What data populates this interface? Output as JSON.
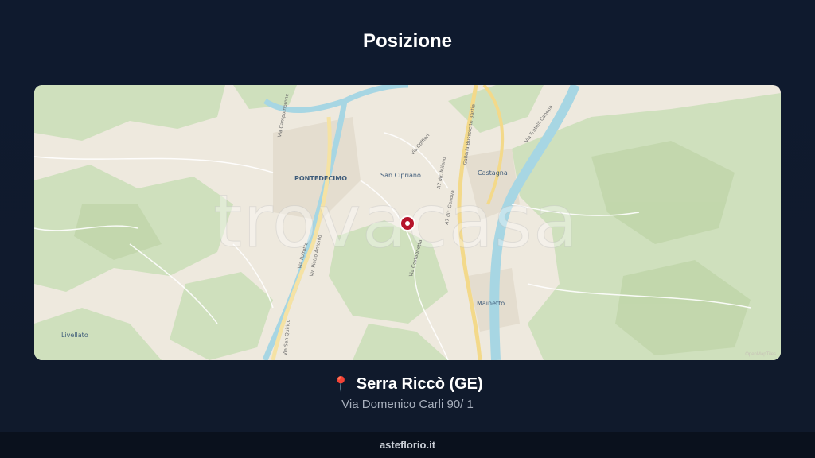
{
  "header": {
    "title": "Posizione"
  },
  "map": {
    "watermark": "trovacasa",
    "attribution": "OpenMapTiles",
    "places": [
      {
        "name": "PONTEDECIMO"
      },
      {
        "name": "San Cipriano"
      },
      {
        "name": "Castagna"
      },
      {
        "name": "Mainetto"
      },
      {
        "name": "Livellato"
      }
    ],
    "roads": [
      "Via Campomorone",
      "Via Pietro Antonio",
      "Via Poirotto",
      "Via San Quirico",
      "A7 dir. Milano",
      "A7 dir. Genova",
      "Galleria Bussoletto Bastia",
      "Via Fratelli Canepa",
      "Via Coffieri",
      "Via Costagnetta"
    ],
    "colors": {
      "land": "#eee9de",
      "vegetation": "#cfe0bd",
      "river": "#a7d6e3",
      "highway": "#f3d98a",
      "marker": "#b5142a"
    }
  },
  "location": {
    "icon": "pin-icon",
    "city": "Serra Riccò (GE)",
    "address": "Via Domenico Carli 90/ 1"
  },
  "footer": {
    "site": "asteflorio.it"
  }
}
